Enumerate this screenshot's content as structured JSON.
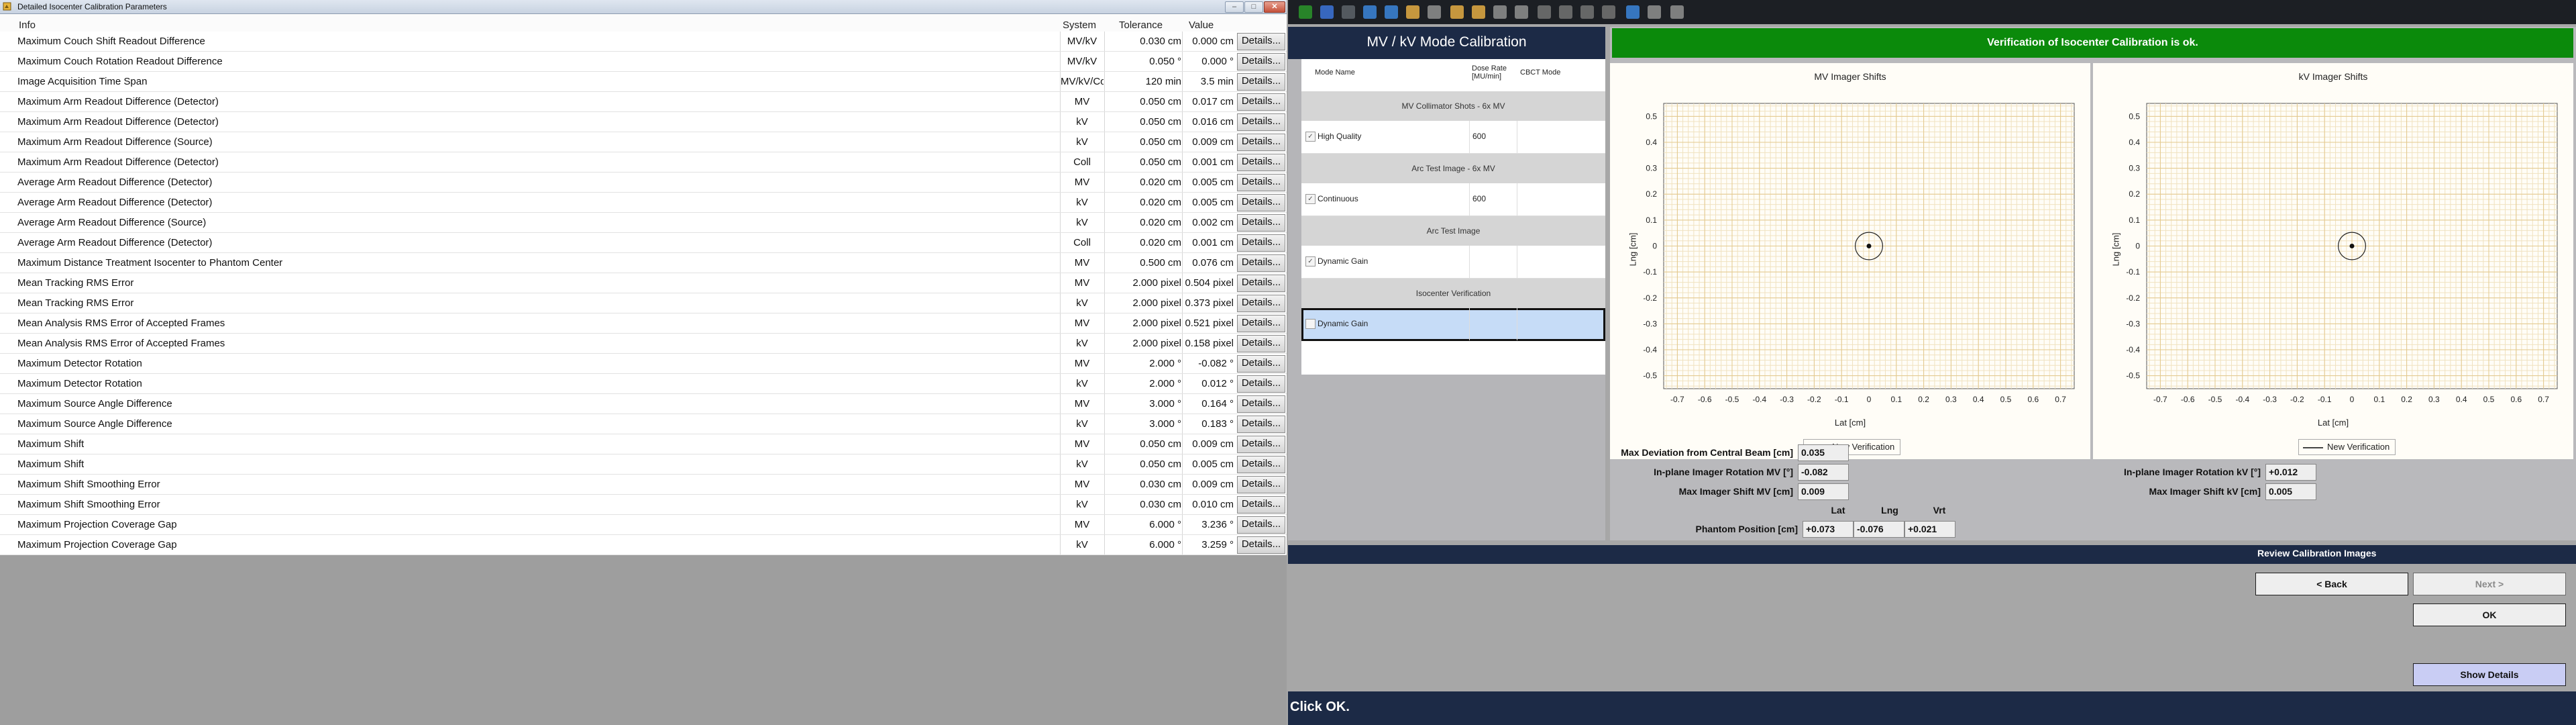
{
  "left_window": {
    "title": "Detailed Isocenter Calibration Parameters",
    "buttons": {
      "minimize": "–",
      "maximize": "□",
      "close": "✕"
    },
    "columns": {
      "info": "Info",
      "system": "System",
      "tolerance": "Tolerance",
      "value": "Value"
    },
    "details_label": "Details...",
    "rows": [
      {
        "info": "Maximum Couch Shift Readout Difference",
        "system": "MV/kV",
        "tolerance": "0.030 cm",
        "value": "0.000 cm"
      },
      {
        "info": "Maximum Couch Rotation Readout Difference",
        "system": "MV/kV",
        "tolerance": "0.050 °",
        "value": "0.000 °"
      },
      {
        "info": "Image Acquisition Time Span",
        "system": "MV/kV/Coll",
        "tolerance": "120 min",
        "value": "3.5 min"
      },
      {
        "info": "Maximum Arm Readout Difference (Detector)",
        "system": "MV",
        "tolerance": "0.050 cm",
        "value": "0.017 cm"
      },
      {
        "info": "Maximum Arm Readout Difference (Detector)",
        "system": "kV",
        "tolerance": "0.050 cm",
        "value": "0.016 cm"
      },
      {
        "info": "Maximum Arm Readout Difference (Source)",
        "system": "kV",
        "tolerance": "0.050 cm",
        "value": "0.009 cm"
      },
      {
        "info": "Maximum Arm Readout Difference (Detector)",
        "system": "Coll",
        "tolerance": "0.050 cm",
        "value": "0.001 cm"
      },
      {
        "info": "Average Arm Readout Difference (Detector)",
        "system": "MV",
        "tolerance": "0.020 cm",
        "value": "0.005 cm"
      },
      {
        "info": "Average Arm Readout Difference (Detector)",
        "system": "kV",
        "tolerance": "0.020 cm",
        "value": "0.005 cm"
      },
      {
        "info": "Average Arm Readout Difference (Source)",
        "system": "kV",
        "tolerance": "0.020 cm",
        "value": "0.002 cm"
      },
      {
        "info": "Average Arm Readout Difference (Detector)",
        "system": "Coll",
        "tolerance": "0.020 cm",
        "value": "0.001 cm"
      },
      {
        "info": "Maximum Distance Treatment Isocenter to Phantom Center",
        "system": "MV",
        "tolerance": "0.500 cm",
        "value": "0.076 cm"
      },
      {
        "info": "Mean Tracking RMS Error",
        "system": "MV",
        "tolerance": "2.000 pixel",
        "value": "0.504 pixel"
      },
      {
        "info": "Mean Tracking RMS Error",
        "system": "kV",
        "tolerance": "2.000 pixel",
        "value": "0.373 pixel"
      },
      {
        "info": "Mean Analysis RMS Error of Accepted Frames",
        "system": "MV",
        "tolerance": "2.000 pixel",
        "value": "0.521 pixel"
      },
      {
        "info": "Mean Analysis RMS Error of Accepted Frames",
        "system": "kV",
        "tolerance": "2.000 pixel",
        "value": "0.158 pixel"
      },
      {
        "info": "Maximum Detector Rotation",
        "system": "MV",
        "tolerance": "2.000 °",
        "value": "-0.082 °"
      },
      {
        "info": "Maximum Detector Rotation",
        "system": "kV",
        "tolerance": "2.000 °",
        "value": "0.012 °"
      },
      {
        "info": "Maximum Source Angle Difference",
        "system": "MV",
        "tolerance": "3.000 °",
        "value": "0.164 °"
      },
      {
        "info": "Maximum Source Angle Difference",
        "system": "kV",
        "tolerance": "3.000 °",
        "value": "0.183 °"
      },
      {
        "info": "Maximum Shift",
        "system": "MV",
        "tolerance": "0.050 cm",
        "value": "0.009 cm"
      },
      {
        "info": "Maximum Shift",
        "system": "kV",
        "tolerance": "0.050 cm",
        "value": "0.005 cm"
      },
      {
        "info": "Maximum Shift Smoothing Error",
        "system": "MV",
        "tolerance": "0.030 cm",
        "value": "0.009 cm"
      },
      {
        "info": "Maximum Shift Smoothing Error",
        "system": "kV",
        "tolerance": "0.030 cm",
        "value": "0.010 cm"
      },
      {
        "info": "Maximum Projection Coverage Gap",
        "system": "MV",
        "tolerance": "6.000 °",
        "value": "3.236 °"
      },
      {
        "info": "Maximum Projection Coverage Gap",
        "system": "kV",
        "tolerance": "6.000 °",
        "value": "3.259 °"
      }
    ]
  },
  "toolbar": {
    "icons": [
      "back-arrow-icon",
      "select-tool-icon",
      "window-level-icon",
      "zoom-in-icon",
      "zoom-out-icon",
      "pan-hand-icon",
      "undo-icon",
      "ruler-icon",
      "angle-icon",
      "crosshair-icon",
      "grid-icon",
      "layout-1-icon",
      "layout-2-icon",
      "layout-3-icon",
      "layout-4-icon",
      "image-icon",
      "save-icon",
      "info-icon"
    ]
  },
  "mode_panel": {
    "title": "MV / kV Mode Calibration",
    "headers": {
      "mode_name": "Mode Name",
      "dose_rate": "Dose Rate [MU/min]",
      "cbct_mode": "CBCT Mode"
    },
    "sections": [
      {
        "title": "MV Collimator Shots - 6x MV",
        "row": {
          "checked": true,
          "name": "High Quality",
          "dose_rate": "600"
        }
      },
      {
        "title": "Arc Test Image - 6x MV",
        "row": {
          "checked": true,
          "name": "Continuous",
          "dose_rate": "600"
        }
      },
      {
        "title": "Arc Test Image",
        "row": {
          "checked": true,
          "name": "Dynamic Gain",
          "dose_rate": ""
        }
      },
      {
        "title": "Isocenter Verification",
        "row": {
          "checked": false,
          "name": "Dynamic Gain",
          "dose_rate": ""
        }
      }
    ]
  },
  "verification": {
    "banner": "Verification of Isocenter Calibration is ok.",
    "banner_color": "#0b8a0b",
    "max_dev_label": "Max Deviation from Central Beam [cm]",
    "max_dev_value": "0.035",
    "rot_mv_label": "In-plane Imager Rotation MV [°]",
    "rot_mv_value": "-0.082",
    "shift_mv_label": "Max Imager Shift MV [cm]",
    "shift_mv_value": "0.009",
    "rot_kv_label": "In-plane Imager Rotation kV [°]",
    "rot_kv_value": "+0.012",
    "shift_kv_label": "Max Imager Shift kV [cm]",
    "shift_kv_value": "0.005",
    "phantom_label": "Phantom Position [cm]",
    "phantom_headers": {
      "lat": "Lat",
      "lng": "Lng",
      "vrt": "Vrt"
    },
    "phantom_values": {
      "lat": "+0.073",
      "lng": "-0.076",
      "vrt": "+0.021"
    }
  },
  "chart_data": [
    {
      "type": "scatter",
      "title": "MV Imager Shifts",
      "xlabel": "Lat [cm]",
      "ylabel": "Lng [cm]",
      "xlim": [
        -0.75,
        0.75
      ],
      "ylim": [
        -0.55,
        0.55
      ],
      "xticks": [
        "-0.7",
        "-0.6",
        "-0.5",
        "-0.4",
        "-0.3",
        "-0.2",
        "-0.1",
        "0",
        "0.1",
        "0.2",
        "0.3",
        "0.4",
        "0.5",
        "0.6",
        "0.7"
      ],
      "yticks": [
        "0.5",
        "0.4",
        "0.3",
        "0.2",
        "0.1",
        "0",
        "-0.1",
        "-0.2",
        "-0.3",
        "-0.4",
        "-0.5"
      ],
      "grid": true,
      "legend": "bottom-center",
      "series": [
        {
          "name": "New Verification",
          "points": [
            [
              0.0,
              0.0
            ]
          ]
        }
      ],
      "circle_radius": 0.05
    },
    {
      "type": "scatter",
      "title": "kV Imager Shifts",
      "xlabel": "Lat [cm]",
      "ylabel": "Lng [cm]",
      "xlim": [
        -0.75,
        0.75
      ],
      "ylim": [
        -0.55,
        0.55
      ],
      "xticks": [
        "-0.7",
        "-0.6",
        "-0.5",
        "-0.4",
        "-0.3",
        "-0.2",
        "-0.1",
        "0",
        "0.1",
        "0.2",
        "0.3",
        "0.4",
        "0.5",
        "0.6",
        "0.7"
      ],
      "yticks": [
        "0.5",
        "0.4",
        "0.3",
        "0.2",
        "0.1",
        "0",
        "-0.1",
        "-0.2",
        "-0.3",
        "-0.4",
        "-0.5"
      ],
      "grid": true,
      "legend": "bottom-center",
      "series": [
        {
          "name": "New Verification",
          "points": [
            [
              0.0,
              0.0
            ]
          ]
        }
      ],
      "circle_radius": 0.05
    }
  ],
  "review": {
    "label": "Review Calibration Images",
    "back": "< Back",
    "next": "Next >",
    "ok": "OK",
    "show_details": "Show Details"
  },
  "status": {
    "text": "Click OK."
  }
}
